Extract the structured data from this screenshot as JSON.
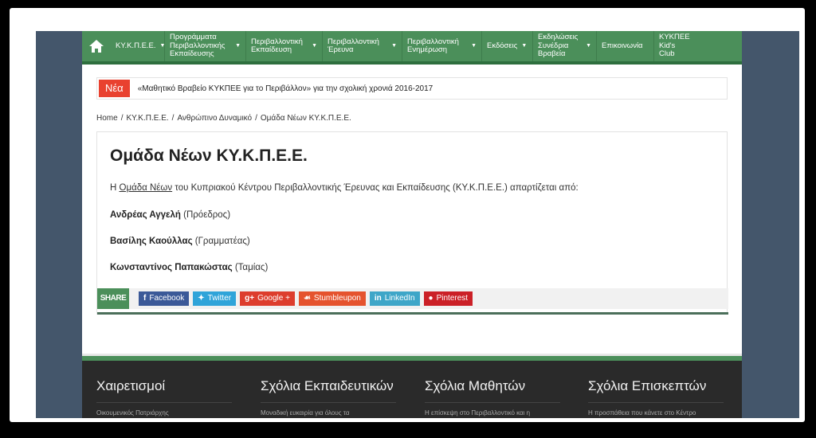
{
  "nav": {
    "items": [
      {
        "label": "ΚΥ.Κ.Π.Ε.Ε.",
        "caret": true
      },
      {
        "label": "Προγράμματα Περιβαλλοντικής Εκπαίδευσης",
        "caret": true
      },
      {
        "label": "Περιβαλλοντική Εκπαίδευση",
        "caret": true
      },
      {
        "label": "Περιβαλλοντική Έρευνα",
        "caret": true
      },
      {
        "label": "Περιβαλλοντική Ενημέρωση",
        "caret": true
      },
      {
        "label": "Εκδόσεις",
        "caret": true
      },
      {
        "label": "Εκδηλώσεις Συνέδρια Βραβεία",
        "caret": true
      },
      {
        "label": "Επικοινωνία",
        "caret": false
      },
      {
        "label": "ΚΥΚΠΕΕ Kid's Club",
        "caret": false
      }
    ]
  },
  "ticker": {
    "label": "Νέα",
    "text": "«Μαθητικό Βραβείο ΚΥΚΠΕΕ για το Περιβάλλον» για την σχολική χρονιά 2016-2017"
  },
  "breadcrumb": [
    "Home",
    "ΚΥ.Κ.Π.Ε.Ε.",
    "Ανθρώπινο Δυναμικό",
    "Ομάδα Νέων ΚΥ.Κ.Π.Ε.Ε."
  ],
  "article": {
    "title": "Ομάδα Νέων ΚΥ.Κ.Π.Ε.Ε.",
    "intro_prefix": "Η ",
    "intro_link": "Ομάδα Νέων",
    "intro_suffix": " του Κυπριακού Κέντρου Περιβαλλοντικής Έρευνας και Εκπαίδευσης (ΚΥ.Κ.Π.Ε.Ε.) απαρτίζεται από:",
    "members": [
      {
        "name": "Ανδρέας Αγγελή",
        "role": "(Πρόεδρος)"
      },
      {
        "name": "Βασίλης Καούλλας",
        "role": "(Γραμματέας)"
      },
      {
        "name": "Κωνσταντίνος Παπακώστας",
        "role": "(Ταμίας)"
      }
    ]
  },
  "share": {
    "label": "SHARE",
    "buttons": [
      {
        "label": "Facebook",
        "icon": "f",
        "color": "#3b5998"
      },
      {
        "label": "Twitter",
        "icon": "t",
        "color": "#2fa4d9"
      },
      {
        "label": "Google +",
        "icon": "g+",
        "color": "#dd3d2d"
      },
      {
        "label": "Stumbleupon",
        "icon": "su",
        "color": "#e5532e"
      },
      {
        "label": "LinkedIn",
        "icon": "in",
        "color": "#3ea6c8"
      },
      {
        "label": "Pinterest",
        "icon": "p",
        "color": "#cb2027"
      }
    ]
  },
  "footer": {
    "columns": [
      {
        "title": "Χαιρετισμοί",
        "snippet": "Οικουμενικός Πατριάρχης"
      },
      {
        "title": "Σχόλια Εκπαιδευτικών",
        "snippet": "Μοναδική ευκαιρία για όλους τα"
      },
      {
        "title": "Σχόλια Μαθητών",
        "snippet": "Η επίσκεψη στο Περιβαλλοντικό και η"
      },
      {
        "title": "Σχόλια Επισκεπτών",
        "snippet": "Η προσπάθεια που κάνετε στο Κέντρο"
      }
    ]
  }
}
